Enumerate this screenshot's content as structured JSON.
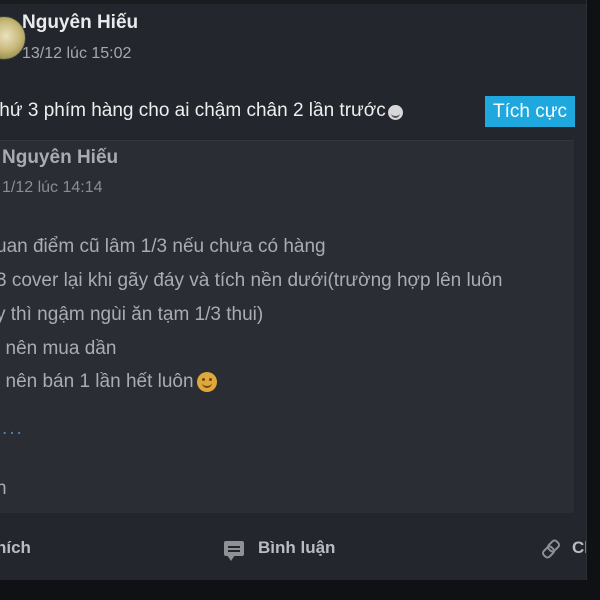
{
  "post": {
    "author": "Nguyên Hiếu",
    "timestamp": "13/12 lúc 15:02",
    "text": "thứ 3 phím hàng cho ai chậm chân 2 lần trước",
    "sentiment_tag": "Tích cực"
  },
  "quoted_post": {
    "author": "Nguyên Hiếu",
    "timestamp": "1/12 lúc 14:14",
    "lines": [
      "uan điểm cũ lâm 1/3 nếu chưa có hàng",
      "3 cover lại khi gãy đáy và tích nền dưới(trường hợp lên luôn",
      "y thì ngậm ngùi ăn tạm 1/3 thui)",
      "i nên mua dần",
      "i nên bán 1 lần hết luôn"
    ],
    "see_more": "...",
    "short_line": "h"
  },
  "actions": {
    "like": "hích",
    "comment": "Bình luận",
    "share": "Ch"
  },
  "icons": {
    "avatar": "avatar-image",
    "emoji_inline": "laughing-emoji-icon",
    "smile": "smile-emoji-icon",
    "comment": "comment-icon",
    "share": "link-icon"
  },
  "colors": {
    "card_background": "#23262c",
    "quote_background": "#2a2d33",
    "tag_background": "#1ea8de",
    "link_color": "#4b86c0"
  }
}
